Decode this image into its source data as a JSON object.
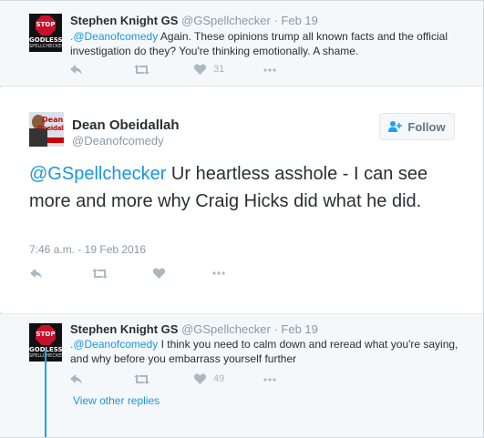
{
  "tweets": [
    {
      "avatar": {
        "sign": "STOP",
        "line1": "GODLESS",
        "line2": "SPELLCHECKER"
      },
      "name": "Stephen Knight GS",
      "handle": "@GSpellchecker",
      "separator": "·",
      "date": "Feb 19",
      "mention": ".@Deanofcomedy",
      "text": " Again. These opinions trump all known facts and the official investigation do they? You're thinking emotionally. A shame.",
      "like_count": "31"
    },
    {
      "avatar": {
        "line1": "Dean",
        "line2": "Obeidallah"
      },
      "name": "Dean Obeidallah",
      "handle": "@Deanofcomedy",
      "follow_label": "Follow",
      "mention": "@GSpellchecker",
      "text": " Ur heartless asshole - I can see more and more why Craig Hicks did what he did.",
      "timestamp": "7:46 a.m. - 19 Feb 2016"
    },
    {
      "avatar": {
        "sign": "STOP",
        "line1": "GODLESS",
        "line2": "SPELLCHECKER"
      },
      "name": "Stephen Knight GS",
      "handle": "@GSpellchecker",
      "separator": "·",
      "date": "Feb 19",
      "mention": ".@Deanofcomedy",
      "text": " I think you need to calm down and reread what you're saying, and why before you embarrass yourself further",
      "like_count": "49",
      "view_replies": "View other replies"
    }
  ],
  "icons": [
    "reply-icon",
    "retweet-icon",
    "like-icon",
    "more-icon",
    "follow-user-icon"
  ],
  "colors": {
    "link": "#1b95e0",
    "muted": "#8899a6",
    "icon": "#aab8c2",
    "thread_line": "#1da1f2",
    "stop_red": "#c8102e"
  }
}
